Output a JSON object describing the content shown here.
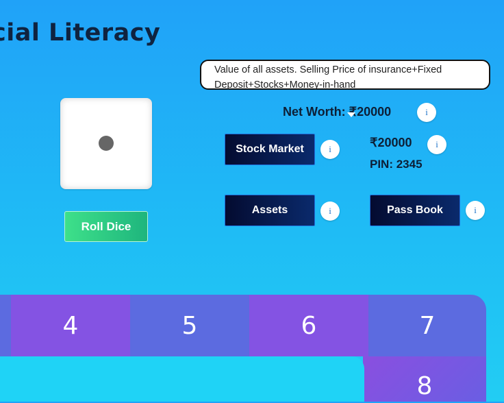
{
  "header": {
    "title": "cial Literacy"
  },
  "tooltip": {
    "text": "Value of all assets. Selling Price of insurance+Fixed Deposit+Stocks+Money-in-hand"
  },
  "dice": {
    "value": 1
  },
  "roll_button": {
    "label": "Roll Dice"
  },
  "net_worth": {
    "label": "Net Worth: ₹20000"
  },
  "info_icon": {
    "glyph": "i"
  },
  "stock_market": {
    "label": "Stock Market"
  },
  "money": {
    "amount": "₹20000"
  },
  "pin": {
    "label": "PIN: 2345"
  },
  "assets": {
    "label": "Assets"
  },
  "passbook": {
    "label": "Pass Book"
  },
  "board": {
    "cells": [
      "4",
      "5",
      "6",
      "7"
    ],
    "cell_8": "8",
    "colors": {
      "cell_a": "#8453e3",
      "cell_b": "#5c6be0",
      "accent": "#1fd3f6"
    }
  }
}
